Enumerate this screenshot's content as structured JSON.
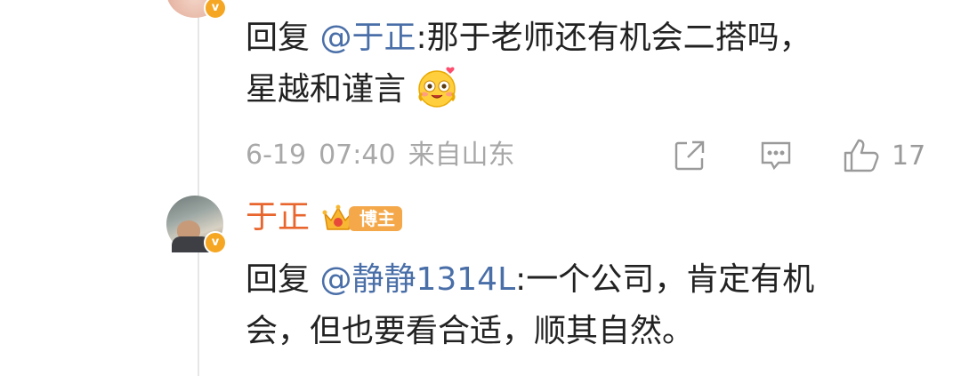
{
  "reply1": {
    "prefix": "回复 ",
    "mention": "@于正",
    "text_line1": ":那于老师还有机会二搭吗，",
    "text_line2": "星越和谨言"
  },
  "meta": {
    "date": "6-19",
    "time": "07:40",
    "location": "来自山东"
  },
  "actions": {
    "share_icon": "share-icon",
    "comment_icon": "comment-icon",
    "like_icon": "thumbs-up-icon",
    "like_count": "17"
  },
  "comment2": {
    "username": "于正",
    "badge": "博主",
    "prefix": "回复 ",
    "mention": "@静静1314L",
    "text_line1": ":一个公司，肯定有机",
    "text_line2": "会，但也要看合适，顺其自然。"
  },
  "colors": {
    "mention": "#4a6fa8",
    "username": "#e8662e",
    "badge": "#f4a84a",
    "meta": "#a8a8a8",
    "verified": "#f5a623"
  }
}
